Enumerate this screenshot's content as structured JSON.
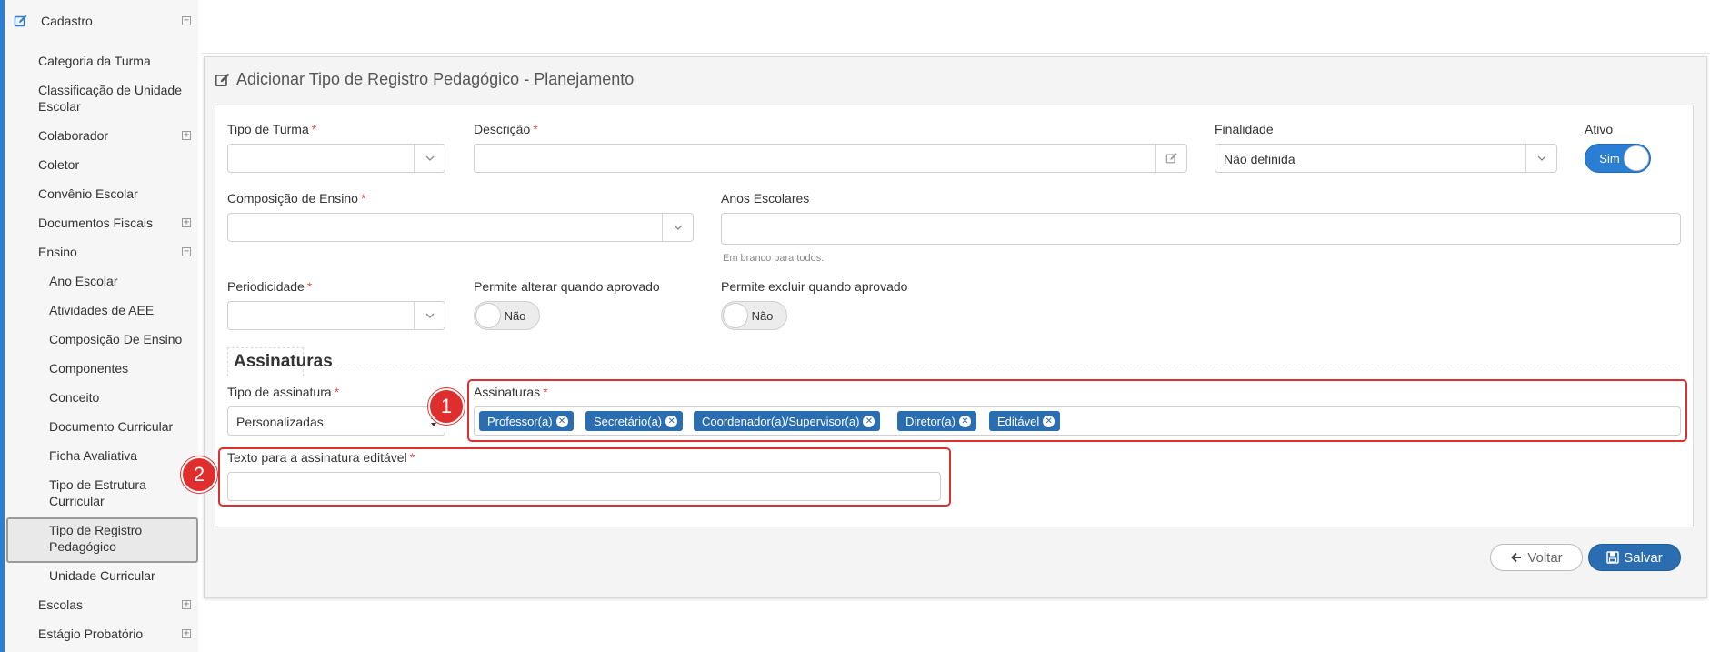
{
  "sidebar": {
    "section": "Cadastro",
    "items": [
      {
        "label": "Categoria da Turma"
      },
      {
        "label": "Classificação de Unidade Escolar"
      },
      {
        "label": "Colaborador"
      },
      {
        "label": "Coletor"
      },
      {
        "label": "Convênio Escolar"
      },
      {
        "label": "Documentos Fiscais"
      },
      {
        "label": "Ensino"
      },
      {
        "label": "Ano Escolar"
      },
      {
        "label": "Atividades de AEE"
      },
      {
        "label": "Composição De Ensino"
      },
      {
        "label": "Componentes"
      },
      {
        "label": "Conceito"
      },
      {
        "label": "Documento Curricular"
      },
      {
        "label": "Ficha Avaliativa"
      },
      {
        "label": "Tipo de Estrutura Curricular"
      },
      {
        "label": "Tipo de Registro Pedagógico"
      },
      {
        "label": "Unidade Curricular"
      },
      {
        "label": "Escolas"
      },
      {
        "label": "Estágio Probatório"
      }
    ]
  },
  "panel": {
    "title": "Adicionar Tipo de Registro Pedagógico - Planejamento"
  },
  "form": {
    "tipo_turma": {
      "label": "Tipo de Turma",
      "required": "*",
      "value": ""
    },
    "descricao": {
      "label": "Descrição",
      "required": "*",
      "value": ""
    },
    "finalidade": {
      "label": "Finalidade",
      "value": "Não definida"
    },
    "ativo": {
      "label": "Ativo",
      "value": "Sim"
    },
    "composicao": {
      "label": "Composição de Ensino",
      "required": "*",
      "value": ""
    },
    "anos": {
      "label": "Anos Escolares",
      "hint": "Em branco para todos."
    },
    "periodicidade": {
      "label": "Periodicidade",
      "required": "*",
      "value": ""
    },
    "alterar": {
      "label": "Permite alterar quando aprovado",
      "value": "Não"
    },
    "excluir": {
      "label": "Permite excluir quando aprovado",
      "value": "Não"
    },
    "section_assinaturas": "Assinaturas",
    "tipo_assinatura": {
      "label": "Tipo de assinatura",
      "required": "*",
      "value": "Personalizadas"
    },
    "assinaturas": {
      "label": "Assinaturas",
      "required": "*",
      "tags": [
        "Professor(a)",
        "Secretário(a)",
        "Coordenador(a)/Supervisor(a)",
        "Diretor(a)",
        "Editável"
      ]
    },
    "texto_editavel": {
      "label": "Texto para a assinatura editável",
      "required": "*",
      "value": ""
    }
  },
  "annotations": [
    "1",
    "2"
  ],
  "buttons": {
    "back": "Voltar",
    "save": "Salvar"
  },
  "colors": {
    "accent": "#2a7fd4",
    "primary_button": "#2a6db0",
    "highlight": "#e02d2d",
    "required": "#d9534f"
  }
}
